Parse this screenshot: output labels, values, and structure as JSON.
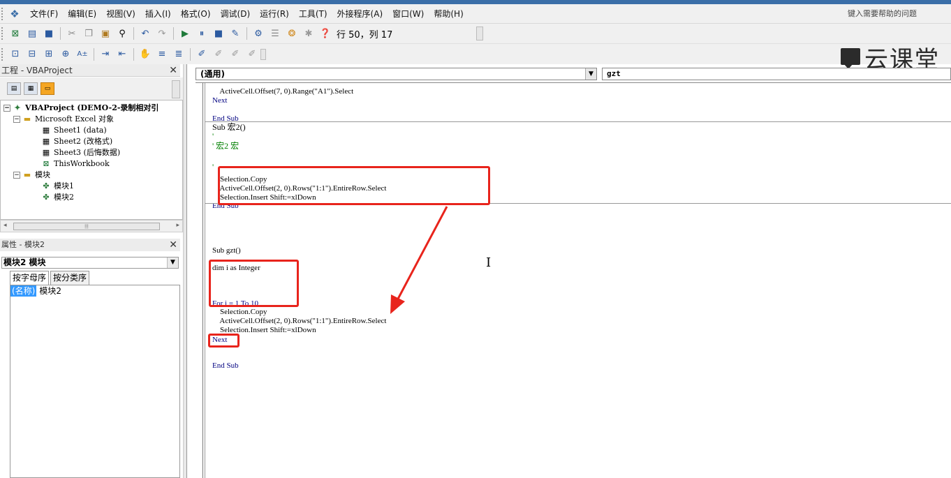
{
  "menubar": {
    "items": [
      "文件(F)",
      "编辑(E)",
      "视图(V)",
      "插入(I)",
      "格式(O)",
      "调试(D)",
      "运行(R)",
      "工具(T)",
      "外接程序(A)",
      "窗口(W)",
      "帮助(H)"
    ],
    "help_placeholder": "键入需要帮助的问题"
  },
  "toolbar": {
    "position_label": "行 50，列 17"
  },
  "watermark": {
    "text": "云课堂"
  },
  "project_panel": {
    "title": "工程 - VBAProject",
    "tree": [
      {
        "label": "VBAProject (DEMO-2-录制相对引",
        "icon": "vbaproject-icon",
        "expander": "−",
        "bold": true
      },
      {
        "label": "Microsoft Excel 对象",
        "icon": "folder-icon",
        "expander": "−"
      },
      {
        "label": "Sheet1 (data)",
        "icon": "sheet-icon"
      },
      {
        "label": "Sheet2 (改格式)",
        "icon": "sheet-icon"
      },
      {
        "label": "Sheet3 (后悔数据)",
        "icon": "sheet-icon"
      },
      {
        "label": "ThisWorkbook",
        "icon": "workbook-icon"
      },
      {
        "label": "模块",
        "icon": "folder-icon",
        "expander": "−"
      },
      {
        "label": "模块1",
        "icon": "module-icon"
      },
      {
        "label": "模块2",
        "icon": "module-icon"
      }
    ]
  },
  "properties_panel": {
    "title": "属性 - 模块2",
    "selected_object": "模块2 模块",
    "tabs": [
      "按字母序",
      "按分类序"
    ],
    "rows": [
      {
        "name": "(名称)",
        "value": "模块2"
      }
    ]
  },
  "code_window": {
    "object_combo": "(通用)",
    "procedure_combo": "gzt",
    "lines": [
      {
        "text": "    ActiveCell.Offset(7, 0).Range(\"A1\").Select",
        "type": "code"
      },
      {
        "text": "Next",
        "type": "kw"
      },
      {
        "text": "",
        "type": "code"
      },
      {
        "text": "End Sub",
        "type": "kw"
      },
      {
        "text": "Sub 宏2()",
        "type": "code"
      },
      {
        "text": "'",
        "type": "cmt"
      },
      {
        "text": "' 宏2 宏",
        "type": "cmt"
      },
      {
        "text": "",
        "type": "code"
      },
      {
        "text": "'",
        "type": "cmt"
      },
      {
        "text": "    Selection.Copy",
        "type": "code"
      },
      {
        "text": "    ActiveCell.Offset(2, 0).Rows(\"1:1\").EntireRow.Select",
        "type": "code"
      },
      {
        "text": "    Selection.Insert Shift:=xlDown",
        "type": "code"
      },
      {
        "text": "End Sub",
        "type": "kw"
      },
      {
        "text": "Sub gzt()",
        "type": "code"
      },
      {
        "text": "dim i as Integer",
        "type": "code"
      },
      {
        "text": "For i = 1 To 10",
        "type": "kw"
      },
      {
        "text": "    Selection.Copy",
        "type": "code"
      },
      {
        "text": "    ActiveCell.Offset(2, 0).Rows(\"1:1\").EntireRow.Select",
        "type": "code"
      },
      {
        "text": "    Selection.Insert Shift:=xlDown",
        "type": "code"
      },
      {
        "text": "Next",
        "type": "kw"
      },
      {
        "text": "End Sub",
        "type": "kw"
      }
    ]
  },
  "annotation_color": "#e8241c"
}
